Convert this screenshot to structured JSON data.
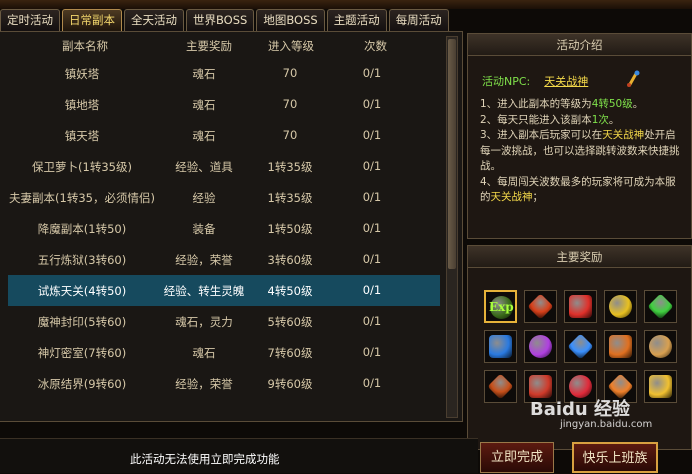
{
  "tabs": [
    {
      "label": "定时活动"
    },
    {
      "label": "日常副本"
    },
    {
      "label": "全天活动"
    },
    {
      "label": "世界BOSS"
    },
    {
      "label": "地图BOSS"
    },
    {
      "label": "主题活动"
    },
    {
      "label": "每周活动"
    }
  ],
  "active_tab": "日常副本",
  "table": {
    "headers": [
      "副本名称",
      "主要奖励",
      "进入等级",
      "次数"
    ],
    "rows": [
      [
        "镇妖塔",
        "魂石",
        "70",
        "0/1"
      ],
      [
        "镇地塔",
        "魂石",
        "70",
        "0/1"
      ],
      [
        "镇天塔",
        "魂石",
        "70",
        "0/1"
      ],
      [
        "保卫萝卜(1转35级)",
        "经验、道具",
        "1转35级",
        "0/1"
      ],
      [
        "夫妻副本(1转35，必须情侣)",
        "经验",
        "1转35级",
        "0/1"
      ],
      [
        "降魔副本(1转50)",
        "装备",
        "1转50级",
        "0/1"
      ],
      [
        "五行炼狱(3转60)",
        "经验，荣誉",
        "3转60级",
        "0/1"
      ],
      [
        "试炼天关(4转50)",
        "经验、转生灵魄",
        "4转50级",
        "0/1"
      ],
      [
        "魔神封印(5转60)",
        "魂石，灵力",
        "5转60级",
        "0/1"
      ],
      [
        "神灯密室(7转60)",
        "魂石",
        "7转60级",
        "0/1"
      ],
      [
        "冰原结界(9转60)",
        "经验，荣誉",
        "9转60级",
        "0/1"
      ]
    ],
    "selected_row": 7
  },
  "intro": {
    "title": "活动介绍",
    "npc_label": "活动NPC:",
    "npc_name": "天关战神",
    "rules": [
      {
        "pre": "1、进入此副本的等级为",
        "hl": "4转50级",
        "post": "。"
      },
      {
        "pre": "2、每天只能进入该副本",
        "hl": "1次",
        "post": "。"
      },
      {
        "pre": "3、进入副本后玩家可以在",
        "hl": "天关战神",
        "post": "处开启每一波挑战，也可以选择跳转波数来快捷挑战。"
      },
      {
        "pre": "4、每周闯关波数最多的玩家将可成为本服的",
        "hl": "天关战神",
        "post": "；"
      }
    ]
  },
  "rewards": {
    "title": "主要奖励",
    "exp_label": "Exp",
    "items": [
      {
        "icon": "exp-orb-icon",
        "color": "#3a6a1a"
      },
      {
        "icon": "red-orb-icon",
        "color": "#d8401a"
      },
      {
        "icon": "red-gem-icon",
        "color": "#e0302a"
      },
      {
        "icon": "yellow-gem-icon",
        "color": "#e8c020"
      },
      {
        "icon": "green-gem-icon",
        "color": "#40d040"
      },
      {
        "icon": "blue-gem-icon",
        "color": "#2a7ae0"
      },
      {
        "icon": "purple-gem-icon",
        "color": "#b040e0"
      },
      {
        "icon": "blue-crystal-icon",
        "color": "#3a90ff"
      },
      {
        "icon": "orange-rune-icon",
        "color": "#e07020"
      },
      {
        "icon": "scroll-icon",
        "color": "#d8a050"
      },
      {
        "icon": "fire-shield-icon",
        "color": "#c8501a"
      },
      {
        "icon": "red-emblem-icon",
        "color": "#d03a2a"
      },
      {
        "icon": "red-jewel-icon",
        "color": "#e02a3a"
      },
      {
        "icon": "orange-jewel-icon",
        "color": "#f0802a"
      },
      {
        "icon": "gold-jewel-icon",
        "color": "#f0c030"
      }
    ]
  },
  "bottom": {
    "notice": "此活动无法使用立即完成功能",
    "complete_label": "立即完成",
    "go_label": "快乐上班族"
  },
  "watermark": {
    "brand": "Baidu 经验",
    "url": "jingyan.baidu.com"
  }
}
